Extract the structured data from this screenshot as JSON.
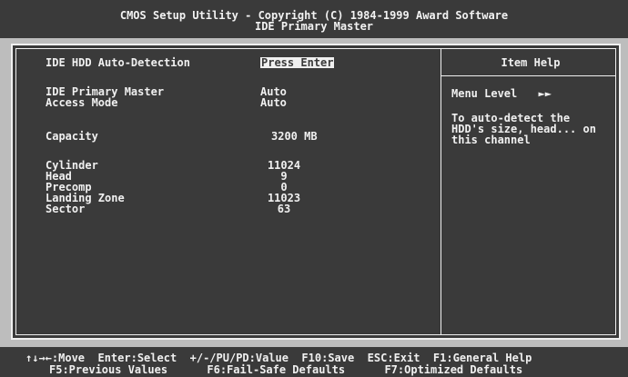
{
  "header": {
    "line1": "CMOS Setup Utility - Copyright (C) 1984-1999 Award Software",
    "line2": "IDE Primary Master"
  },
  "settings": {
    "auto_detect_label": "IDE HDD Auto-Detection",
    "auto_detect_value": "Press Enter",
    "primary_master_label": "IDE Primary Master",
    "primary_master_value": "Auto",
    "access_mode_label": "Access Mode",
    "access_mode_value": "Auto",
    "capacity_label": "Capacity",
    "capacity_value": "3200 MB",
    "cylinder_label": "Cylinder",
    "cylinder_value": "11024",
    "head_label": "Head",
    "head_value": "9",
    "precomp_label": "Precomp",
    "precomp_value": "0",
    "landing_zone_label": "Landing Zone",
    "landing_zone_value": "11023",
    "sector_label": "Sector",
    "sector_value": "63"
  },
  "help": {
    "title": "Item Help",
    "menu_level": "Menu Level",
    "menu_level_marker": "►►",
    "text_line1": "To auto-detect the",
    "text_line2": "HDD's size, head... on",
    "text_line3": "this channel"
  },
  "footer": {
    "line1": "↑↓→←:Move  Enter:Select  +/-/PU/PD:Value  F10:Save  ESC:Exit  F1:General Help",
    "line2": "F5:Previous Values      F6:Fail-Safe Defaults      F7:Optimized Defaults"
  },
  "colors": {
    "background": "#3a3a3a",
    "foreground": "#f0f0f0"
  }
}
